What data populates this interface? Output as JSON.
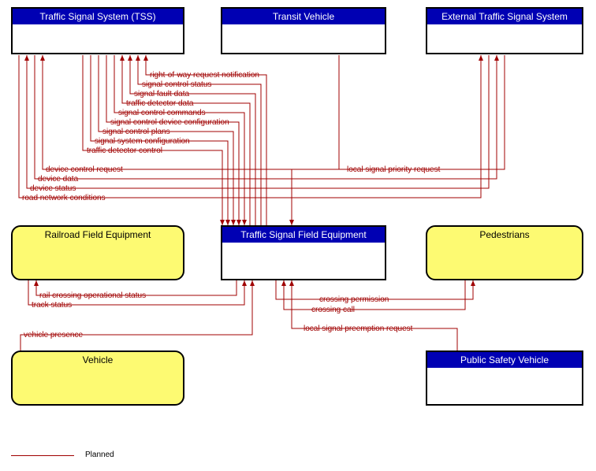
{
  "boxes": {
    "tss": "Traffic Signal System (TSS)",
    "transit_vehicle": "Transit Vehicle",
    "external_tss": "External Traffic Signal System",
    "tsfe": "Traffic Signal Field Equipment",
    "railroad": "Railroad Field Equipment",
    "pedestrians": "Pedestrians",
    "vehicle": "Vehicle",
    "psv": "Public Safety Vehicle"
  },
  "flows": {
    "rowrn": "right-of-way request notification",
    "scs": "signal control status",
    "sfd": "signal fault data",
    "tdd": "traffic detector data",
    "scc": "signal control commands",
    "scdc": "signal control device configuration",
    "scp": "signal control plans",
    "ssc": "signal system configuration",
    "tdc": "traffic detector control",
    "dcr": "device control request",
    "dd": "device data",
    "ds": "device status",
    "rnc": "road network conditions",
    "lspr": "local signal priority request",
    "rcos": "rail crossing operational status",
    "ts": "track status",
    "vp": "vehicle presence",
    "cp": "crossing permission",
    "cc": "crossing call",
    "lsprq": "local signal preemption request"
  },
  "legend": "Planned"
}
